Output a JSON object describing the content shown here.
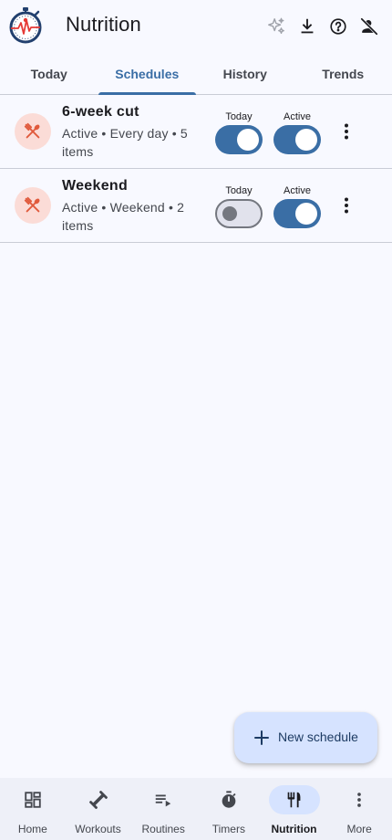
{
  "app": {
    "title": "Nutrition"
  },
  "colors": {
    "accent": "#3a6ea5",
    "icon_bg": "#fbdcd7",
    "icon_fg": "#e05a3c",
    "fab_bg": "#d6e3ff",
    "background": "#f8f9ff"
  },
  "top_actions": [
    {
      "icon": "sparkle-icon"
    },
    {
      "icon": "download-icon"
    },
    {
      "icon": "help-icon"
    },
    {
      "icon": "account-off-icon"
    }
  ],
  "tabs": [
    {
      "label": "Today",
      "active": false
    },
    {
      "label": "Schedules",
      "active": true
    },
    {
      "label": "History",
      "active": false
    },
    {
      "label": "Trends",
      "active": false
    }
  ],
  "schedules": [
    {
      "title": "6-week cut",
      "subtitle": "Active • Every day • 5 items",
      "icon": "utensils-icon",
      "today_label": "Today",
      "active_label": "Active",
      "today_on": true,
      "active_on": true
    },
    {
      "title": "Weekend",
      "subtitle": "Active • Weekend • 2 items",
      "icon": "utensils-icon",
      "today_label": "Today",
      "active_label": "Active",
      "today_on": false,
      "active_on": true
    }
  ],
  "fab": {
    "label": "New schedule",
    "icon": "plus-icon"
  },
  "bottom_nav": [
    {
      "label": "Home",
      "icon": "dashboard-icon",
      "active": false
    },
    {
      "label": "Workouts",
      "icon": "dumbbell-icon",
      "active": false
    },
    {
      "label": "Routines",
      "icon": "playlist-icon",
      "active": false
    },
    {
      "label": "Timers",
      "icon": "timer-icon",
      "active": false
    },
    {
      "label": "Nutrition",
      "icon": "fork-knife-icon",
      "active": true
    },
    {
      "label": "More",
      "icon": "more-vertical-icon",
      "active": false
    }
  ]
}
